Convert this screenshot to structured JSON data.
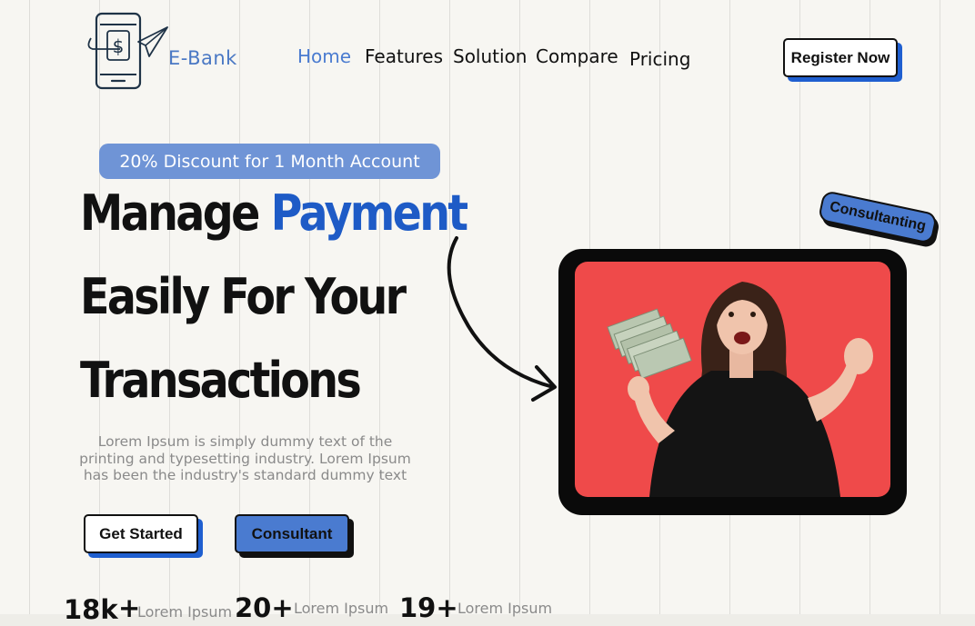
{
  "brand": {
    "name": "E-Bank"
  },
  "nav": {
    "items": [
      "Home",
      "Features",
      "Solution",
      "Compare",
      "Pricing"
    ],
    "active": "Home"
  },
  "header": {
    "register_label": "Register Now"
  },
  "hero": {
    "discount": "20% Discount for 1 Month Account",
    "headline_line1_plain": "Manage ",
    "headline_line1_accent": "Payment",
    "headline_line2": "Easily For Your",
    "headline_line3": "Transactions",
    "description": "Lorem Ipsum is simply dummy text of the printing and typesetting industry. Lorem Ipsum has been the industry's standard dummy text",
    "get_started_label": "Get Started",
    "consultant_label": "Consultant",
    "badge_label": "Consultanting"
  },
  "stats": [
    {
      "number": "18k",
      "plus": "+",
      "label": "Lorem Ipsum"
    },
    {
      "number": "20+",
      "label": "Lorem Ipsum"
    },
    {
      "number": "19+",
      "label": "Lorem Ipsum"
    }
  ],
  "colors": {
    "accent": "#1e5bc6",
    "nav_active": "#4a7bd0",
    "pill": "#6f94d6",
    "photo_bg": "#ef4a4a",
    "button_shadow": "#1f5fd0"
  },
  "icons": {
    "logo": "phone-dollar-paper-plane-icon",
    "arrow": "curved-arrow-icon"
  }
}
